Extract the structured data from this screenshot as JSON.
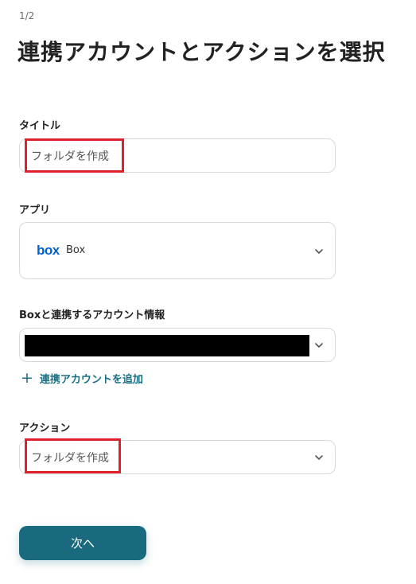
{
  "step": "1/2",
  "page_title": "連携アカウントとアクションを選択",
  "title_field": {
    "label": "タイトル",
    "value": "フォルダを作成"
  },
  "app_field": {
    "label": "アプリ",
    "logo_text": "box",
    "app_name": "Box"
  },
  "account_field": {
    "label": "Boxと連携するアカウント情報"
  },
  "add_account": {
    "icon": "plus-icon",
    "label": "連携アカウントを追加"
  },
  "action_field": {
    "label": "アクション",
    "value": "フォルダを作成"
  },
  "next_button": {
    "label": "次へ"
  },
  "colors": {
    "accent": "#1a6a7f",
    "highlight": "#e0202a",
    "box_brand": "#0061d5"
  }
}
